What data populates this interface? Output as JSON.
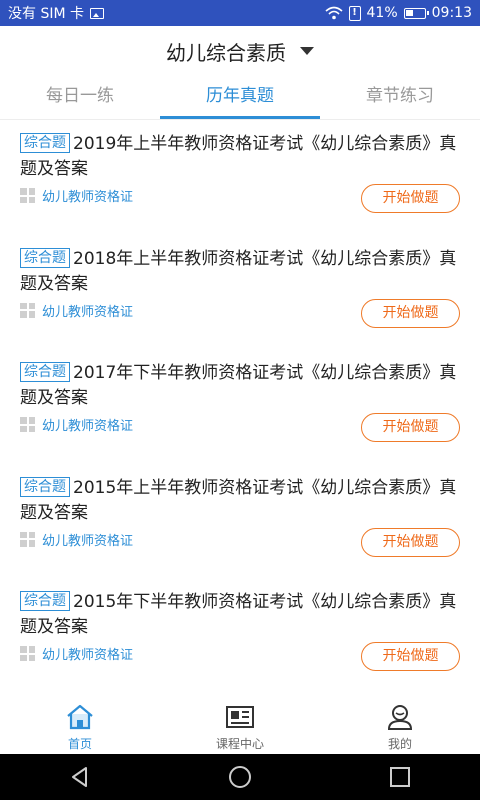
{
  "status_bar": {
    "carrier": "没有 SIM 卡",
    "battery": "41%",
    "time": "09:13"
  },
  "header": {
    "title": "幼儿综合素质"
  },
  "tabs": [
    {
      "label": "每日一练"
    },
    {
      "label": "历年真题"
    },
    {
      "label": "章节练习"
    }
  ],
  "items": [
    {
      "tag": "综合题",
      "title": "2019年上半年教师资格证考试《幼儿综合素质》真题及答案",
      "category": "幼儿教师资格证",
      "button": "开始做题"
    },
    {
      "tag": "综合题",
      "title": "2018年上半年教师资格证考试《幼儿综合素质》真题及答案",
      "category": "幼儿教师资格证",
      "button": "开始做题"
    },
    {
      "tag": "综合题",
      "title": "2017年下半年教师资格证考试《幼儿综合素质》真题及答案",
      "category": "幼儿教师资格证",
      "button": "开始做题"
    },
    {
      "tag": "综合题",
      "title": "2015年上半年教师资格证考试《幼儿综合素质》真题及答案",
      "category": "幼儿教师资格证",
      "button": "开始做题"
    },
    {
      "tag": "综合题",
      "title": "2015年下半年教师资格证考试《幼儿综合素质》真题及答案",
      "category": "幼儿教师资格证",
      "button": "开始做题"
    }
  ],
  "bottom_nav": [
    {
      "label": "首页",
      "icon": "home-icon"
    },
    {
      "label": "课程中心",
      "icon": "course-icon"
    },
    {
      "label": "我的",
      "icon": "profile-icon"
    }
  ],
  "colors": {
    "status_bar": "#2f52bd",
    "accent": "#2d8ed6",
    "button": "#ef6a1a"
  }
}
